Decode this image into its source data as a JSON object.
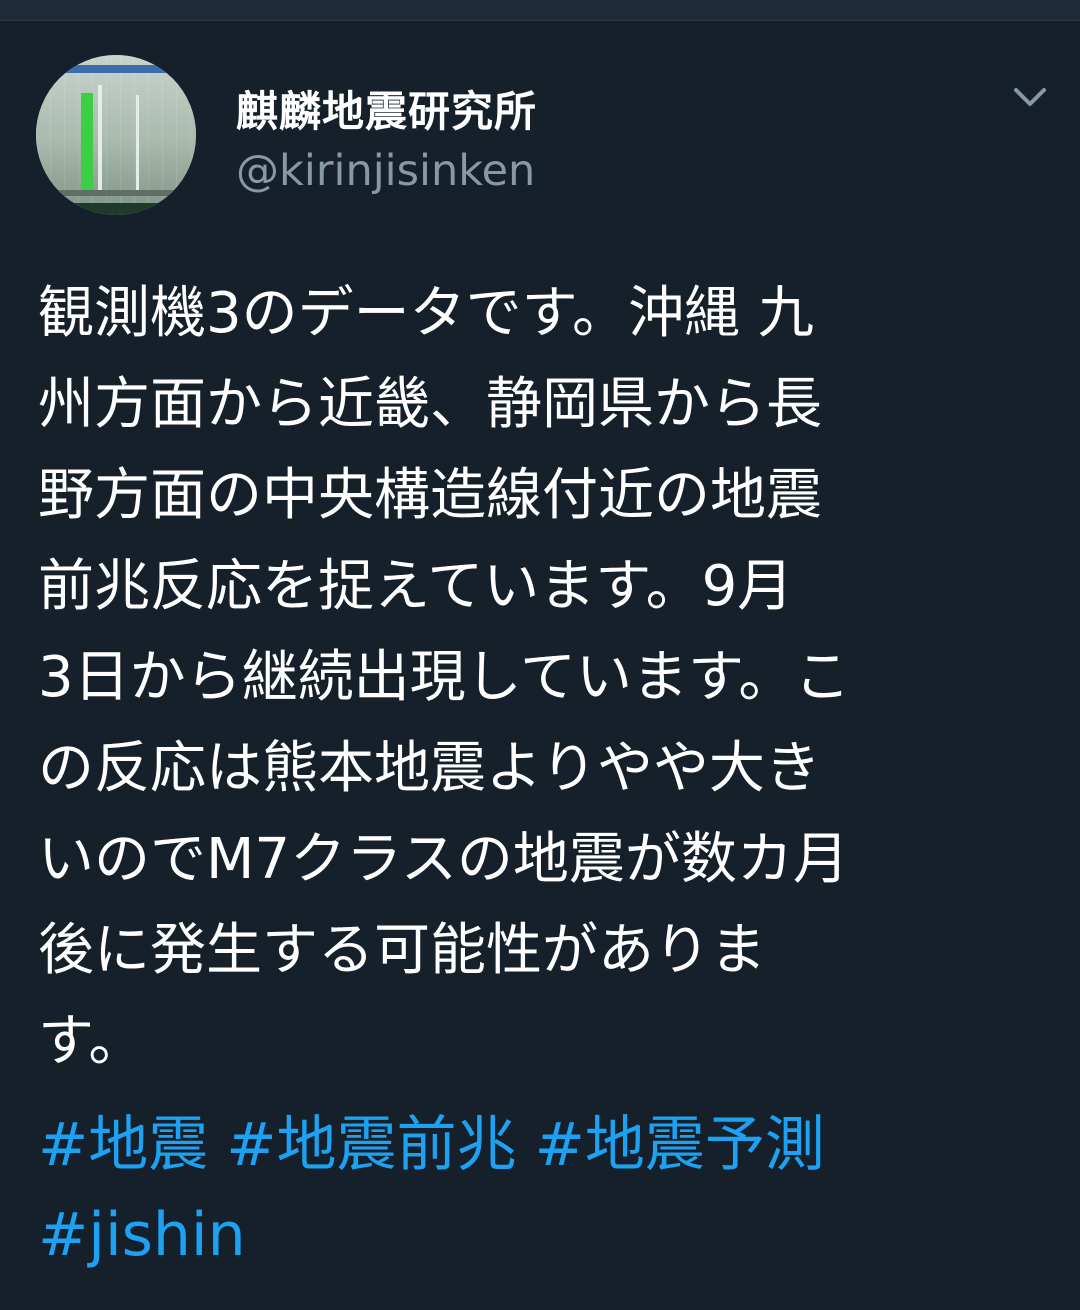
{
  "account": {
    "display_name": "麒麟地震研究所",
    "handle": "@kirinjisinken"
  },
  "icons": {
    "avatar": "avatar-image",
    "menu": "chevron-down-icon"
  },
  "colors": {
    "background": "#15202b",
    "text": "#ffffff",
    "secondary_text": "#8899a6",
    "link": "#1da1f2"
  },
  "tweet": {
    "lines": [
      "観測機3のデータです。沖縄 九",
      "州方面から近畿、静岡県から長",
      "野方面の中央構造線付近の地震",
      "前兆反応を捉えています。9月",
      "3日から継続出現しています。こ",
      "の反応は熊本地震よりやや大き",
      "いのでM7クラスの地震が数カ月",
      "後に発生する可能性がありま",
      "す。"
    ],
    "hashtags": [
      "#地震",
      "#地震前兆",
      "#地震予測",
      "#jishin"
    ]
  }
}
